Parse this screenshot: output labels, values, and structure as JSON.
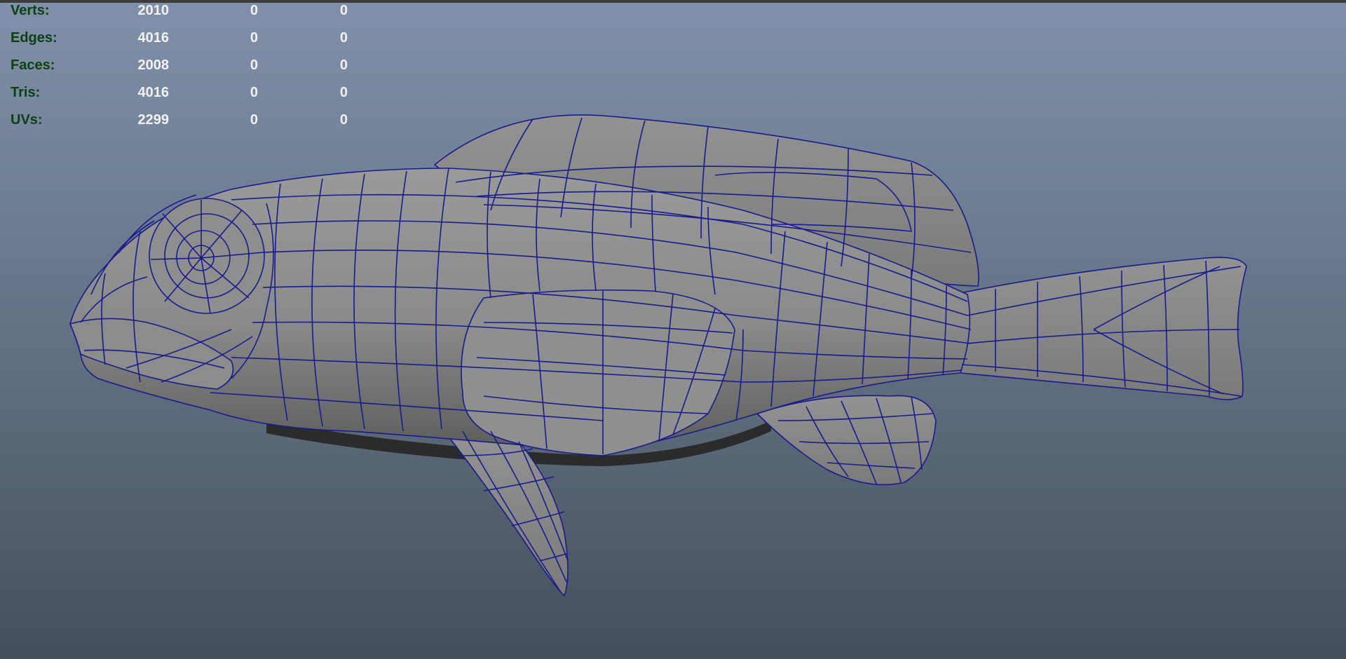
{
  "viewport": {
    "background_top": "#7f90a8",
    "background_bottom": "#454f5b",
    "mesh_fill": "#8a8a8a",
    "wire_color": "#1a1a8c"
  },
  "hud": {
    "label_color": "#0c3f12",
    "value_color": "#f2f2f2",
    "rows": [
      {
        "label": "Verts:",
        "total": "2010",
        "selected": "0",
        "highlighted": "0"
      },
      {
        "label": "Edges:",
        "total": "4016",
        "selected": "0",
        "highlighted": "0"
      },
      {
        "label": "Faces:",
        "total": "2008",
        "selected": "0",
        "highlighted": "0"
      },
      {
        "label": "Tris:",
        "total": "4016",
        "selected": "0",
        "highlighted": "0"
      },
      {
        "label": "UVs:",
        "total": "2299",
        "selected": "0",
        "highlighted": "0"
      }
    ]
  },
  "model": {
    "icon": "fish-mesh"
  }
}
